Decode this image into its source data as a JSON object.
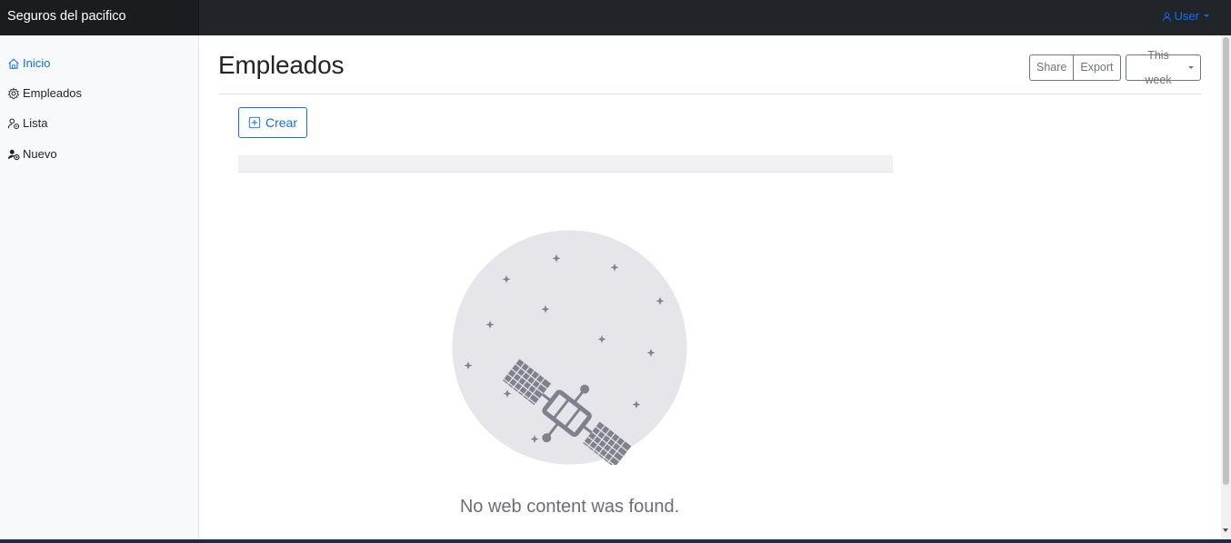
{
  "navbar": {
    "brand": "Seguros del pacifico",
    "user_label": "User"
  },
  "sidebar": {
    "items": [
      {
        "label": "Inicio",
        "icon": "home-icon",
        "active": true
      },
      {
        "label": "Empleados",
        "icon": "gear-icon",
        "active": false
      },
      {
        "label": "Lista",
        "icon": "user-list-icon",
        "active": false
      },
      {
        "label": "Nuevo",
        "icon": "user-add-icon",
        "active": false
      }
    ]
  },
  "main": {
    "title": "Empleados",
    "toolbar": {
      "share_label": "Share",
      "export_label": "Export",
      "period_label": "This week"
    },
    "create_button": "Crear",
    "empty_state": {
      "message": "No web content was found.",
      "icon": "satellite-icon"
    }
  },
  "colors": {
    "accent": "#0d6efd",
    "navbar": "#212529",
    "muted": "#6c757d"
  }
}
